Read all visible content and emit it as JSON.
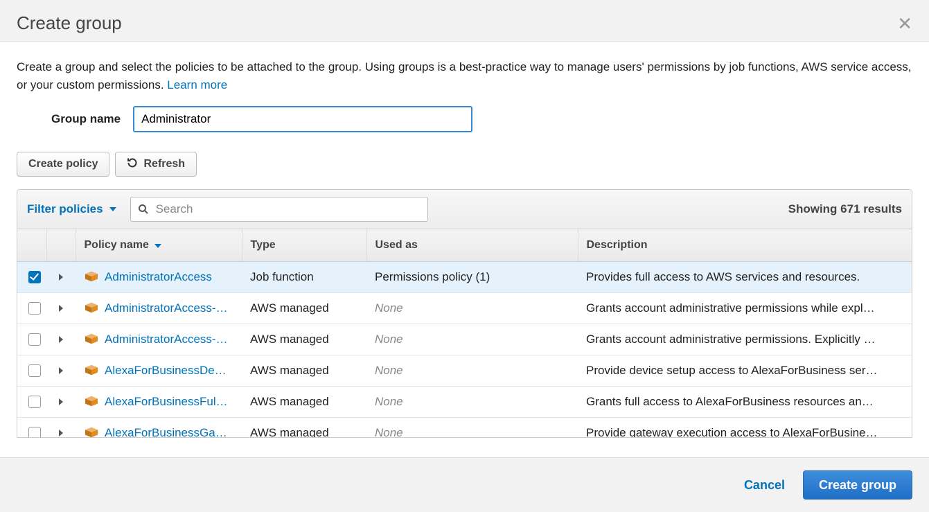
{
  "modal": {
    "title": "Create group",
    "close_icon": "✕",
    "intro_text": "Create a group and select the policies to be attached to the group. Using groups is a best-practice way to manage users' permissions by job functions, AWS service access, or your custom permissions. ",
    "learn_more": "Learn more"
  },
  "form": {
    "group_name_label": "Group name",
    "group_name_value": "Administrator"
  },
  "buttons": {
    "create_policy": "Create policy",
    "refresh": "Refresh"
  },
  "toolbar": {
    "filter_label": "Filter policies",
    "search_placeholder": "Search",
    "results_text": "Showing 671 results"
  },
  "table": {
    "headers": {
      "policy_name": "Policy name",
      "type": "Type",
      "used_as": "Used as",
      "description": "Description"
    },
    "rows": [
      {
        "checked": true,
        "name": "AdministratorAccess",
        "type": "Job function",
        "used_as": "Permissions policy (1)",
        "used_as_none": false,
        "description": "Provides full access to AWS services and resources."
      },
      {
        "checked": false,
        "name": "AdministratorAccess-…",
        "type": "AWS managed",
        "used_as": "None",
        "used_as_none": true,
        "description": "Grants account administrative permissions while expl…"
      },
      {
        "checked": false,
        "name": "AdministratorAccess-…",
        "type": "AWS managed",
        "used_as": "None",
        "used_as_none": true,
        "description": "Grants account administrative permissions. Explicitly …"
      },
      {
        "checked": false,
        "name": "AlexaForBusinessDe…",
        "type": "AWS managed",
        "used_as": "None",
        "used_as_none": true,
        "description": "Provide device setup access to AlexaForBusiness ser…"
      },
      {
        "checked": false,
        "name": "AlexaForBusinessFull…",
        "type": "AWS managed",
        "used_as": "None",
        "used_as_none": true,
        "description": "Grants full access to AlexaForBusiness resources an…"
      },
      {
        "checked": false,
        "name": "AlexaForBusinessGat…",
        "type": "AWS managed",
        "used_as": "None",
        "used_as_none": true,
        "description": "Provide gateway execution access to AlexaForBusine…"
      }
    ]
  },
  "footer": {
    "cancel": "Cancel",
    "create_group": "Create group"
  },
  "colors": {
    "accent": "#0073bb",
    "policy_icon": "#e38b1f"
  }
}
